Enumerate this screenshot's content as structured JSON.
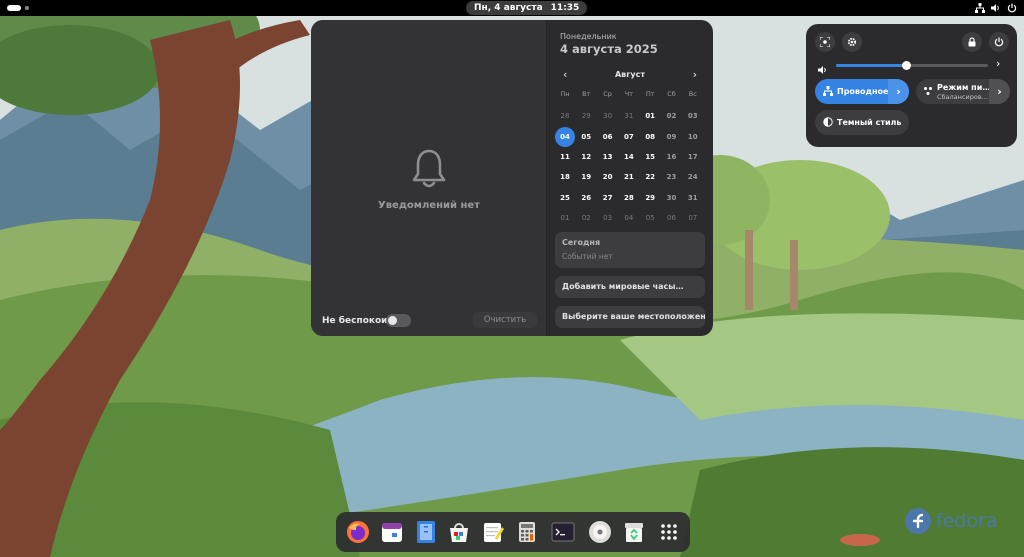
{
  "topbar": {
    "clock_date": "Пн, 4 августа",
    "clock_time": "11:35"
  },
  "notifications": {
    "empty_text": "Уведомлений нет",
    "dnd_label": "Не беспокоить",
    "dnd_enabled": false,
    "clear_label": "Очистить"
  },
  "calendar": {
    "weekday": "Понедельник",
    "date": "4 августа 2025",
    "month": "Август",
    "weekdays": [
      "Пн",
      "Вт",
      "Ср",
      "Чт",
      "Пт",
      "Сб",
      "Вс"
    ],
    "weeks": [
      [
        "28",
        "29",
        "30",
        "31",
        "01",
        "02",
        "03"
      ],
      [
        "04",
        "05",
        "06",
        "07",
        "08",
        "09",
        "10"
      ],
      [
        "11",
        "12",
        "13",
        "14",
        "15",
        "16",
        "17"
      ],
      [
        "18",
        "19",
        "20",
        "21",
        "22",
        "23",
        "24"
      ],
      [
        "25",
        "26",
        "27",
        "28",
        "29",
        "30",
        "31"
      ],
      [
        "01",
        "02",
        "03",
        "04",
        "05",
        "06",
        "07"
      ]
    ],
    "today": "04",
    "today_title": "Сегодня",
    "no_events": "Событий нет",
    "world_clocks": "Добавить мировые часы…",
    "location": "Выберите ваше местоположение…"
  },
  "quick_settings": {
    "volume_percent": 46,
    "wired_label": "Проводное",
    "power_mode_label": "Режим пи…",
    "power_mode_sub": "Сбалансиров…",
    "dark_style_label": "Темный стиль"
  },
  "dock": {
    "apps": [
      "firefox-icon",
      "calendar-icon",
      "text-editor-icon",
      "software-icon",
      "notes-icon",
      "calculator-icon",
      "terminal-icon",
      "disk-icon",
      "trash-icon",
      "app-grid-icon"
    ]
  },
  "branding": {
    "logo_text": "fedora"
  },
  "colors": {
    "accent": "#3584e4",
    "panel": "#2b2b2d"
  }
}
